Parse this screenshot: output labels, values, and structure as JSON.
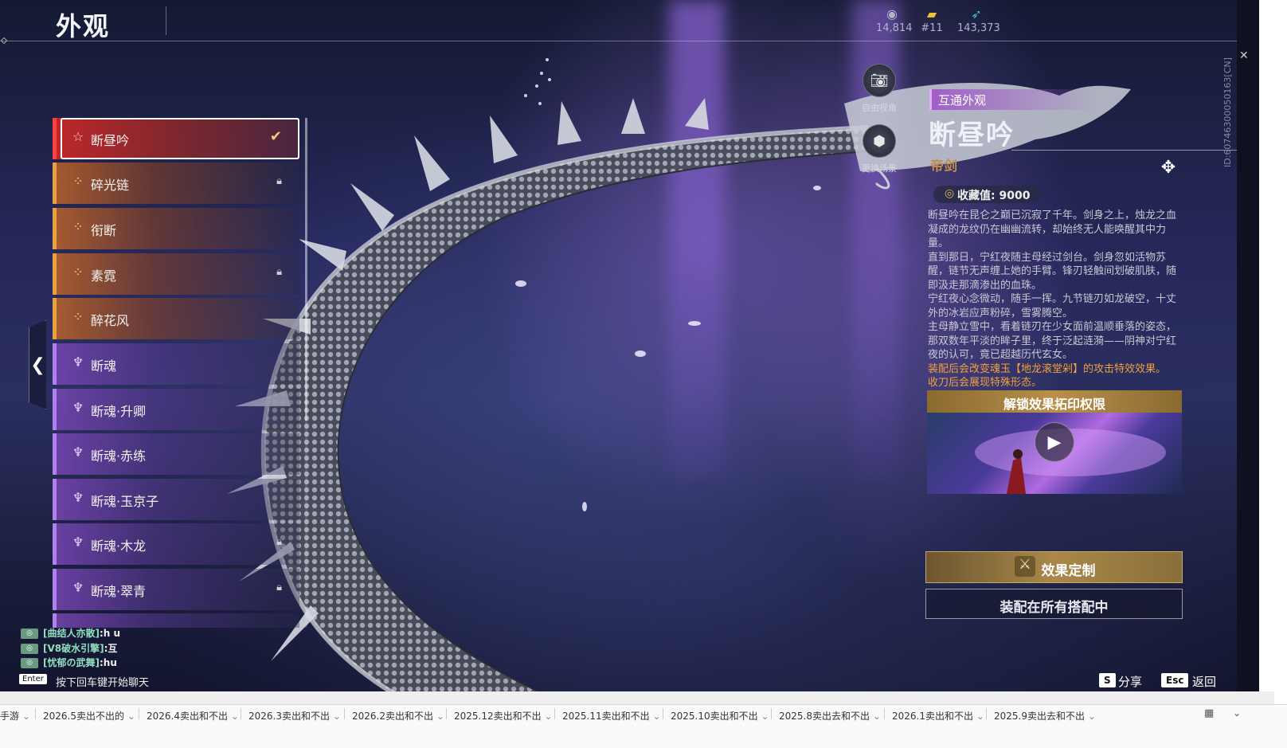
{
  "header": {
    "title": "外观",
    "currencies": [
      {
        "icon": "coin-stack-icon",
        "value": "14,814"
      },
      {
        "icon": "ticket-icon",
        "value": "#11"
      },
      {
        "icon": "feather-icon",
        "value": "143,373"
      }
    ]
  },
  "skin_list": {
    "items": [
      {
        "label": "断昼吟",
        "rarity": "red",
        "selected": true,
        "locked": false
      },
      {
        "label": "碎光链",
        "rarity": "orange",
        "selected": false,
        "locked": true
      },
      {
        "label": "衔断",
        "rarity": "orange",
        "selected": false,
        "locked": false
      },
      {
        "label": "素霓",
        "rarity": "orange",
        "selected": false,
        "locked": true
      },
      {
        "label": "醉花风",
        "rarity": "orange",
        "selected": false,
        "locked": false
      },
      {
        "label": "断魂",
        "rarity": "purple",
        "selected": false,
        "locked": false
      },
      {
        "label": "断魂·升卿",
        "rarity": "purple",
        "selected": false,
        "locked": false
      },
      {
        "label": "断魂·赤练",
        "rarity": "purple",
        "selected": false,
        "locked": false
      },
      {
        "label": "断魂·玉京子",
        "rarity": "purple",
        "selected": false,
        "locked": false
      },
      {
        "label": "断魂·木龙",
        "rarity": "purple",
        "selected": false,
        "locked": true
      },
      {
        "label": "断魂·翠青",
        "rarity": "purple",
        "selected": false,
        "locked": true
      }
    ]
  },
  "view_buttons": {
    "free_view": "自由视角",
    "change_scene": "更换场景"
  },
  "detail": {
    "tag": "互通外观",
    "title": "断昼吟",
    "subtitle": "帝剑",
    "collect_label": "收藏值: 9000",
    "description": [
      "断昼吟在昆仑之巅已沉寂了千年。剑身之上，烛龙之血凝成的龙纹仍在幽幽流转，却始终无人能唤醒其中力量。",
      "直到那日，宁红夜随主母经过剑台。剑身忽如活物苏醒，链节无声缠上她的手臂。锋刃轻触间划破肌肤，随即汲走那滴渗出的血珠。",
      "宁红夜心念微动，随手一挥。九节链刃如龙破空，十丈外的冰岩应声粉碎，雪雾腾空。",
      "主母静立雪中，看着链刃在少女面前温顺垂落的姿态，那双数年平淡的眸子里，终于泛起涟漪——阴神对宁红夜的认可，竟已超越历代玄女。"
    ],
    "highlight": [
      "装配后会改变魂玉【地龙滚堂剁】的攻击特效效果。",
      "收刀后会展现特殊形态。"
    ],
    "unlock_header": "解锁效果拓印权限",
    "custom_button": "效果定制",
    "equip_button": "装配在所有搭配中",
    "id_text": "ID:60746300050163[CN]"
  },
  "chat": [
    {
      "user": "[曲结人亦散]",
      "msg": ":h u"
    },
    {
      "user": "[V8破水引擎]",
      "msg": ":互"
    },
    {
      "user": "[忧郁の武舞]",
      "msg": ":hu"
    }
  ],
  "chat_hint": {
    "key": "Enter",
    "text": "按下回车键开始聊天"
  },
  "actions": [
    {
      "key": "S",
      "label": "分享"
    },
    {
      "key": "Esc",
      "label": "返回"
    }
  ],
  "sheet_tabs": [
    "手游",
    "2026.5卖出不出的",
    "2026.4卖出和不出",
    "2026.3卖出和不出",
    "2026.2卖出和不出",
    "2025.12卖出和不出",
    "2025.11卖出和不出",
    "2025.10卖出和不出",
    "2025.8卖出去和不出",
    "2026.1卖出和不出",
    "2025.9卖出去和不出"
  ],
  "colors": {
    "accent_red": "#e03838",
    "orange": "#e8a040",
    "purple": "#b080f0",
    "gold": "#b8904a"
  }
}
